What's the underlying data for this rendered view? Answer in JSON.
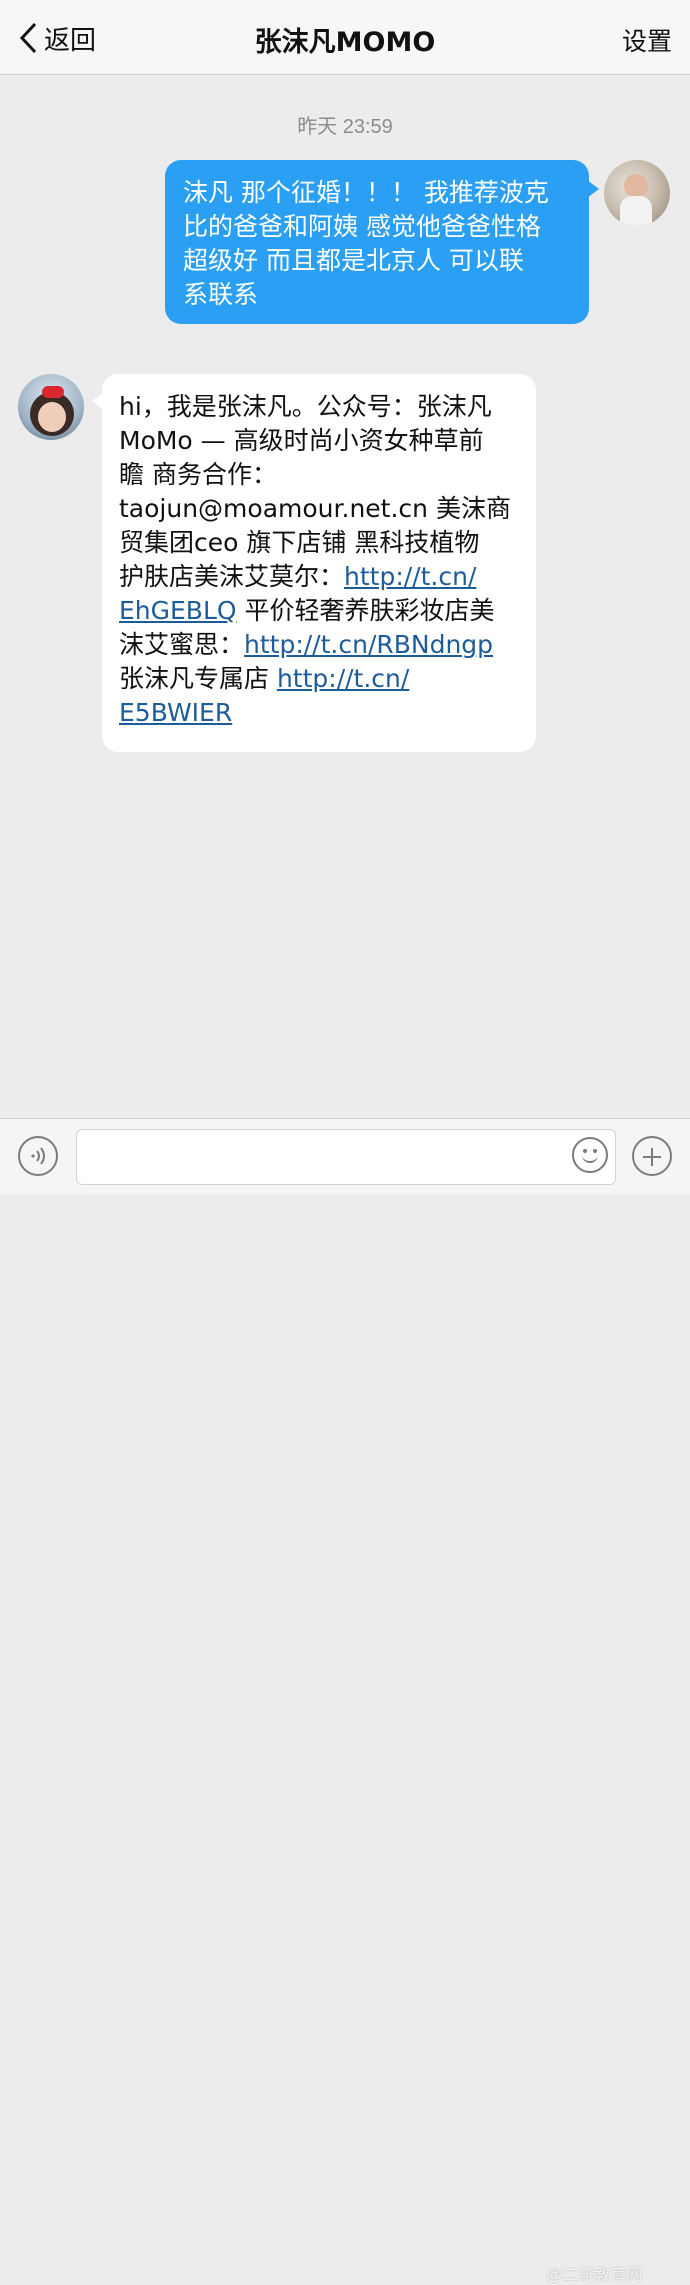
{
  "navbar": {
    "back_label": "返回",
    "title": "张沫凡MOMO",
    "settings_label": "设置"
  },
  "conversation": {
    "timestamp": "昨天 23:59",
    "outgoing_message": {
      "lines": [
        "沫凡 那个征婚！！！ 我推荐波克",
        "比的爸爸和阿姨  感觉他爸爸性格",
        "超级好   而且都是北京人 可以联",
        "系联系"
      ]
    },
    "incoming_message": {
      "line1": "hi，我是张沫凡。公众号：张沫凡",
      "line2": "MoMo — 高级时尚小资女种草前",
      "line3": "瞻 商务合作：",
      "line4": "taojun@moamour.net.cn 美沫商",
      "line5": "贸集团ceo 旗下店铺 黑科技植物",
      "line6_text": "护肤店美沫艾莫尔：",
      "link1_part1": "http://t.cn/",
      "link1_part2": "EhGEBLQ",
      "line7_text": " 平价轻奢养肤彩妆店美",
      "line8_text": "沫艾蜜思：",
      "link2": "http://t.cn/RBNdngp",
      "line9_text": "张沫凡专属店 ",
      "link3_part1": "http://t.cn/",
      "link3_part2": "E5BWIER"
    }
  },
  "input_bar": {
    "input_value": "",
    "watermark": "@二哥教育网"
  },
  "colors": {
    "outgoing_bubble": "#2a9ff3",
    "incoming_bubble": "#ffffff",
    "link": "#1d5c9a",
    "background": "#ececec"
  },
  "icons": [
    "chevron-left-icon",
    "voice-icon",
    "emoji-icon",
    "plus-icon"
  ]
}
